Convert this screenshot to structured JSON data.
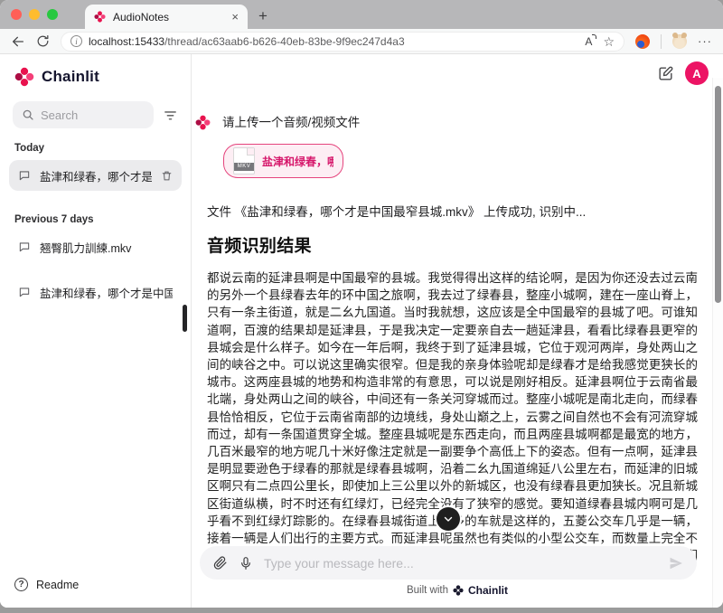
{
  "browser": {
    "tab": {
      "title": "AudioNotes"
    },
    "url": {
      "host": "localhost:15433",
      "path": "/thread/ac63aab6-b626-40eb-83be-9f9ec247d4a3"
    },
    "glyphs": {
      "close": "×",
      "new_tab": "+",
      "more": "···",
      "star": "☆",
      "info": "i",
      "read_aloud": "A"
    }
  },
  "sidebar": {
    "brand": "Chainlit",
    "search_placeholder": "Search",
    "sections": [
      {
        "label": "Today"
      },
      {
        "label": "Previous 7 days"
      }
    ],
    "items": {
      "today_0": "盐津和绿春，哪个才是中...",
      "prev_0": "翘臀肌力訓練.mkv",
      "prev_1": "盐津和绿春，哪个才是中国..."
    },
    "readme": "Readme"
  },
  "header": {
    "avatar": "A"
  },
  "chat": {
    "user_message": "请上传一个音频/视频文件",
    "attachment": {
      "name": "盐津和绿春，哪...",
      "type_badge": "MKV"
    },
    "status": "文件 《盐津和绿春，哪个才是中国最窄县城.mkv》 上传成功, 识别中...",
    "heading": "音频识别结果",
    "transcript": "都说云南的延津县啊是中国最窄的县城。我觉得得出这样的结论啊，是因为你还没去过云南的另外一个县绿春去年的环中国之旅啊，我去过了绿春县，整座小城啊，建在一座山脊上，只有一条主街道，就是二幺九国道。当时我就想，这应该是全中国最窄的县城了吧。可谁知道啊，百渡的结果却是延津县，于是我决定一定要亲自去一趟延津县，看看比绿春县更窄的县城会是什么样子。如今在一年后啊，我终于到了延津县城，它位于观河两岸，身处两山之间的峡谷之中。可以说这里确实很窄。但是我的亲身体验呢却是绿春才是给我感觉更狭长的城市。这两座县城的地势和构造非常的有意思，可以说是刚好相反。延津县啊位于云南省最北端，身处两山之间的峡谷，中间还有一条关河穿城而过。整座小城呢是南北走向，而绿春县恰恰相反，它位于云南省南部的边境线，身处山巅之上，云雾之间自然也不会有河流穿城而过，却有一条国道贯穿全城。整座县城呢是东西走向，而且两座县城啊都是最宽的地方，几百米最窄的地方呢几十米好像注定就是一副要争个高低上下的姿态。但有一点啊，延津县是明显要逊色于绿春的那就是绿春县城啊，沿着二幺九国道绵延八公里左右，而延津的旧城区啊只有二点四公里长，即使加上三公里以外的新城区，也没有绿春县更加狭长。况且新城区街道纵横，时不时还有红绿灯，已经完全没有了狭窄的感觉。要知道绿春县城内啊可是几乎看不到红绿灯踪影的。在绿春县城街道上最多的车就是这样的，五菱公交车几乎是一辆，接着一辆是人们出行的主要方式。而延津县呢虽然也有类似的小型公交车，而数量上完全不是一个量级，似乎人们啊还是习惯于开车出门。城内更多的单行道，显然是为了更方便人们开车，这也从另一个侧面反映出啊，绿春县显然是要更为狭长。但是啊如果你非起了无人机，就会发现，由于"
  },
  "composer": {
    "placeholder": "Type your message here..."
  },
  "footer": {
    "built_with": "Built with",
    "brand": "Chainlit"
  },
  "colors": {
    "accent_pink": "#e8134e",
    "avatar_bg": "#ec1464",
    "attachment_border": "#e5447d",
    "attachment_bg": "#fdeef4",
    "scroll_button_bg": "#1f1f1f"
  }
}
